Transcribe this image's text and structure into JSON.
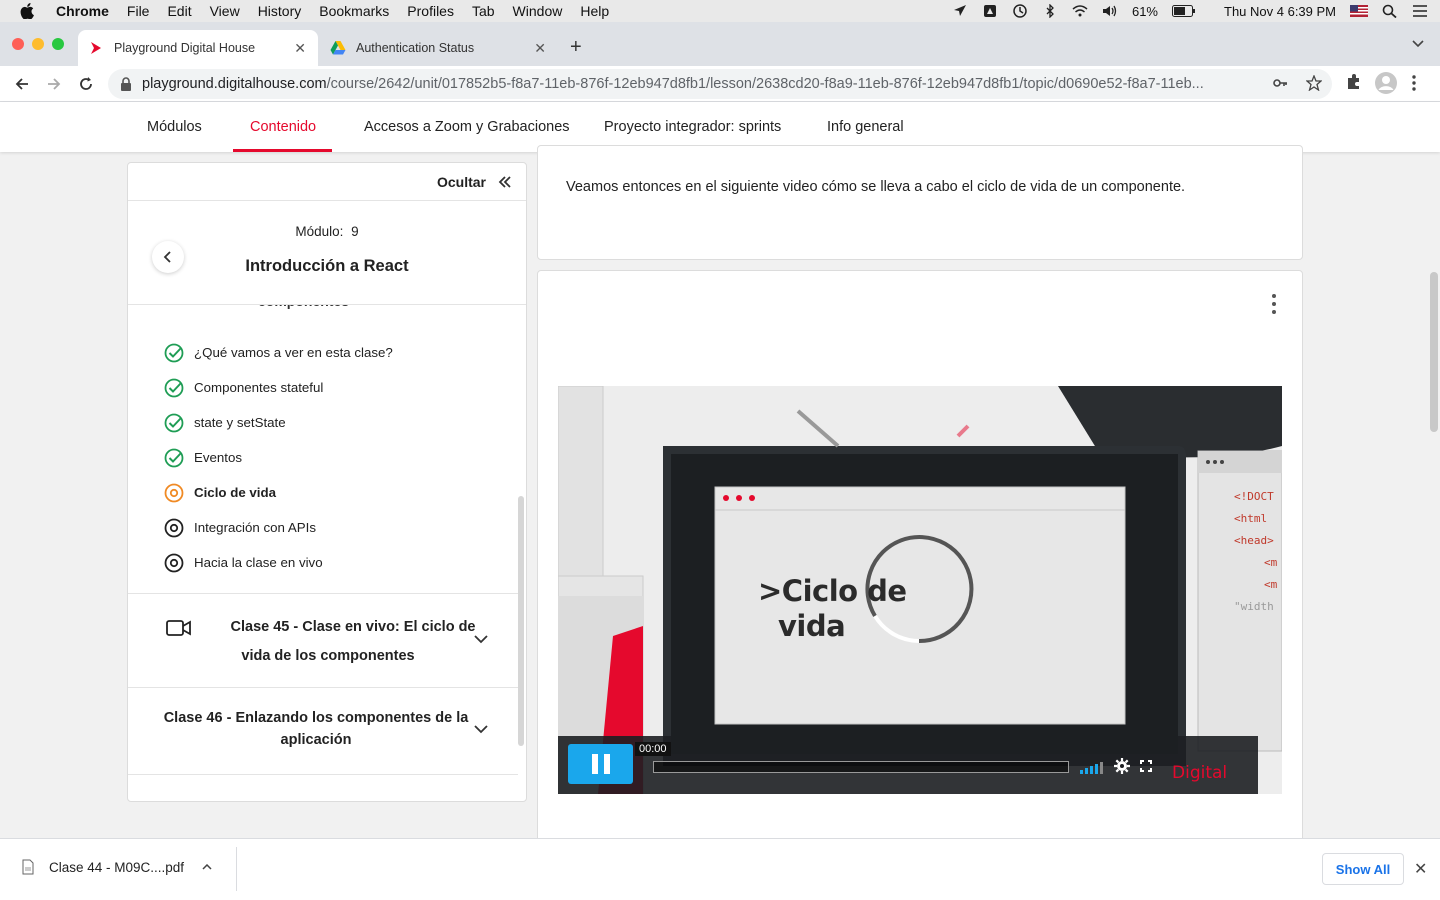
{
  "menubar": {
    "app": "Chrome",
    "items": [
      "File",
      "Edit",
      "View",
      "History",
      "Bookmarks",
      "Profiles",
      "Tab",
      "Window",
      "Help"
    ],
    "battery": "61%",
    "datetime": "Thu Nov 4  6:39 PM"
  },
  "tabs": [
    {
      "title": "Playground Digital House"
    },
    {
      "title": "Authentication Status"
    }
  ],
  "address": {
    "host": "playground.digitalhouse.com",
    "path": "/course/2642/unit/017852b5-f8a7-11eb-876f-12eb947d8fb1/lesson/2638cd20-f8a9-11eb-876f-12eb947d8fb1/topic/d0690e52-f8a7-11eb..."
  },
  "sitenav": {
    "items": [
      "Módulos",
      "Contenido",
      "Accesos a Zoom y Grabaciones",
      "Proyecto integrador: sprints",
      "Info general"
    ],
    "active": "Contenido"
  },
  "sidebar": {
    "hide_label": "Ocultar",
    "module_label": "Módulo:",
    "module_number": "9",
    "module_title": "Introducción a React",
    "cut_text": "componentes",
    "lessons": [
      {
        "label": "¿Qué vamos a ver en esta clase?",
        "status": "done"
      },
      {
        "label": "Componentes stateful",
        "status": "done"
      },
      {
        "label": "state y setState",
        "status": "done"
      },
      {
        "label": "Eventos",
        "status": "done"
      },
      {
        "label": "Ciclo de vida",
        "status": "current"
      },
      {
        "label": "Integración con APIs",
        "status": "pending"
      },
      {
        "label": "Hacia la clase en vivo",
        "status": "pending"
      }
    ],
    "clases": [
      {
        "line1": "Clase 45 - Clase en vivo: El ciclo de",
        "line2": "vida de los componentes"
      },
      {
        "line1": "Clase 46 - Enlazando los componentes de la",
        "line2": "aplicación"
      }
    ]
  },
  "content": {
    "intro_text": "Veamos entonces en el siguiente video cómo se lleva a cabo el ciclo de vida de un componente.",
    "video": {
      "title_line1": ">Ciclo de",
      "title_line2": "vida",
      "time": "00:00",
      "brand": "Digital",
      "code_lines": [
        "<!DOCT",
        "<html",
        "<head>",
        "<m",
        "<m",
        "\"width"
      ]
    }
  },
  "downloads": {
    "file": "Clase 44 - M09C....pdf",
    "show_all": "Show All"
  },
  "colors": {
    "brand_red": "#e5092d",
    "check_green": "#1f9d55",
    "current_orange": "#f08a24",
    "player_blue": "#1aa7ec"
  }
}
